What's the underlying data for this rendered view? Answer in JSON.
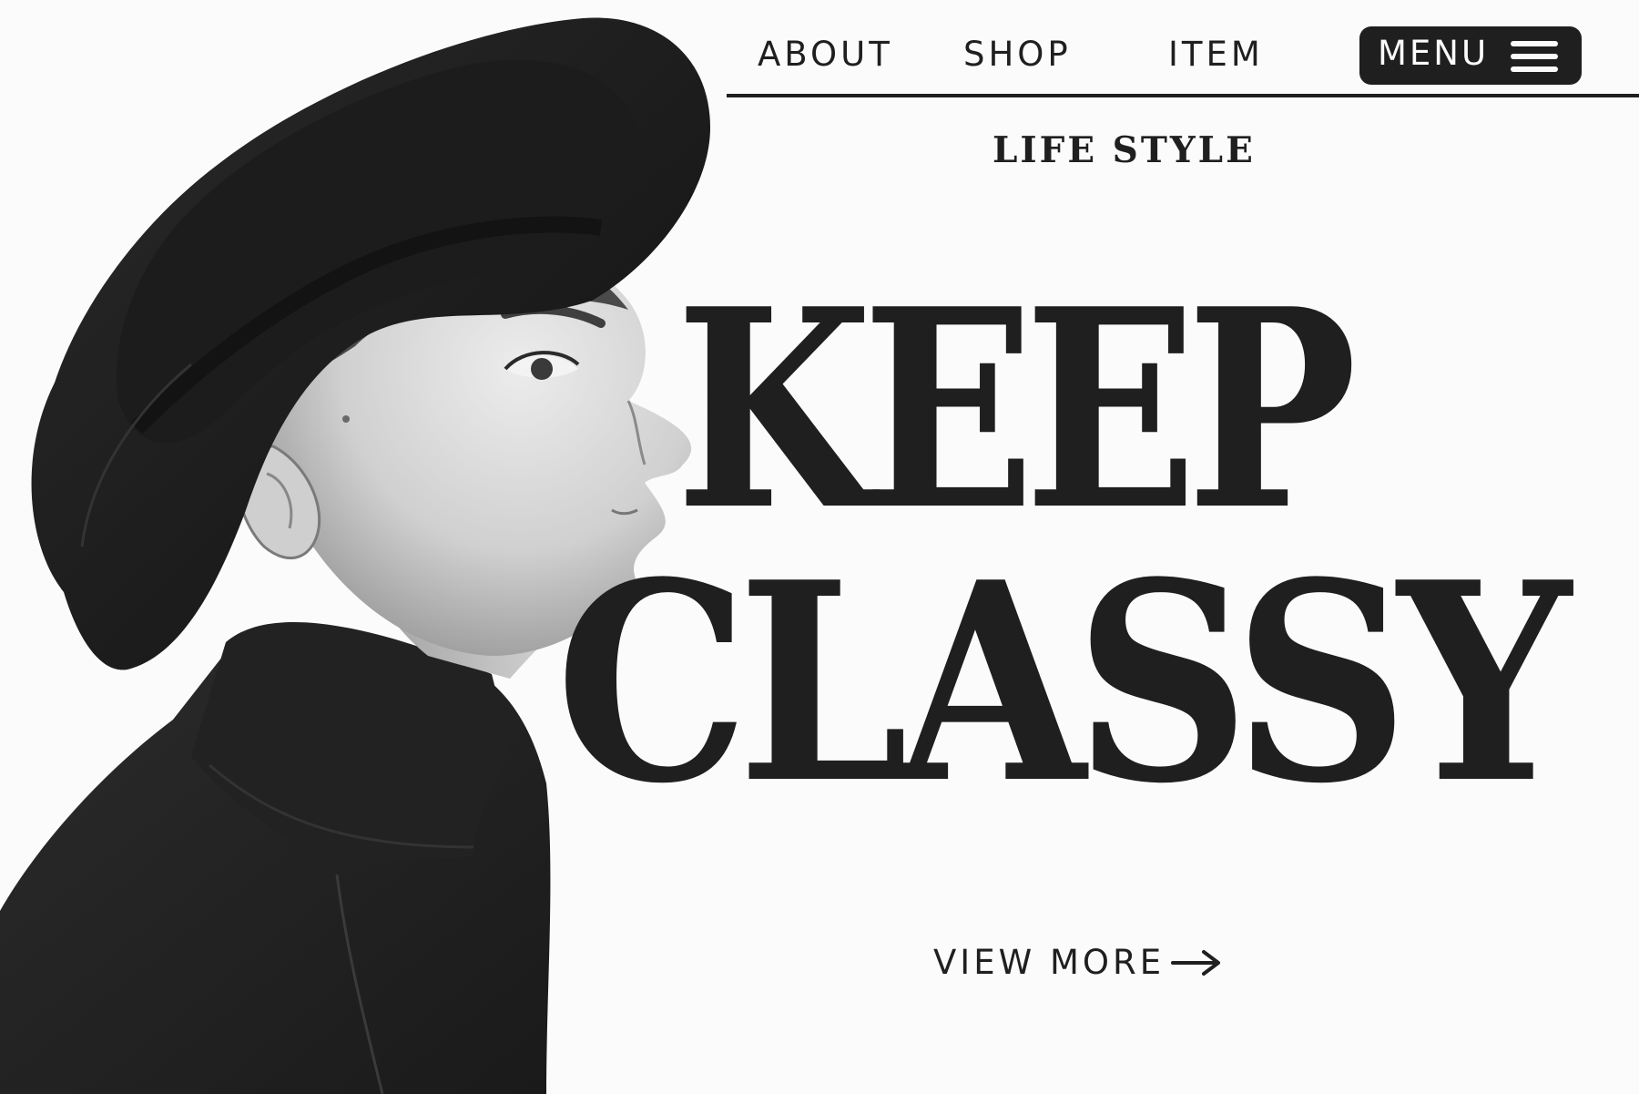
{
  "nav": {
    "links": [
      {
        "label": "ABOUT"
      },
      {
        "label": "SHOP"
      },
      {
        "label": "ITEM"
      }
    ],
    "menu_button": {
      "label": "MENU",
      "icon": "hamburger-icon"
    }
  },
  "hero": {
    "eyebrow": "LIFE STYLE",
    "headline": [
      "KEEP",
      "CLASSY"
    ],
    "cta": {
      "label": "VIEW MORE",
      "icon": "arrow-right-icon"
    },
    "image": "black-and-white portrait of man in black fedora hat and black turtleneck, side profile"
  },
  "colors": {
    "background": "#fbfbfb",
    "ink": "#1f1f1f",
    "button_bg": "#1f1f1f",
    "button_text": "#fbfbfb"
  }
}
